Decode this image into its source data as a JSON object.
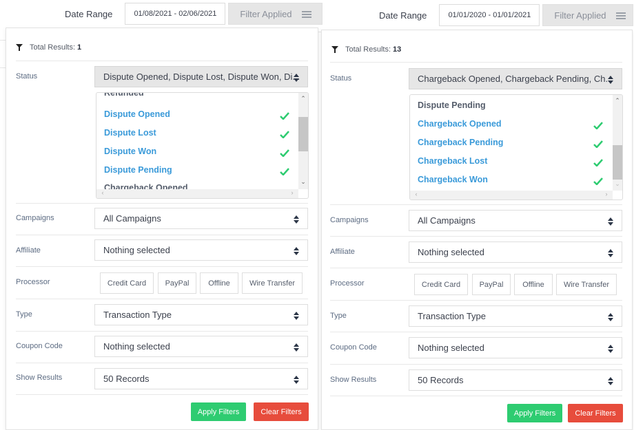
{
  "left": {
    "date_label": "Date Range",
    "date_value": "01/08/2021 - 02/06/2021",
    "filter_button": "Filter Applied",
    "total_label": "Total Results:",
    "total_value": "1",
    "labels": {
      "status": "Status",
      "campaigns": "Campaigns",
      "affiliate": "Affiliate",
      "processor": "Processor",
      "type": "Type",
      "coupon": "Coupon Code",
      "show_results": "Show Results"
    },
    "status_value": "Dispute Opened, Dispute Lost, Dispute Won, Di...",
    "status_options": [
      {
        "label": "Refunded",
        "selected": false
      },
      {
        "label": "Dispute Opened",
        "selected": true
      },
      {
        "label": "Dispute Lost",
        "selected": true
      },
      {
        "label": "Dispute Won",
        "selected": true
      },
      {
        "label": "Dispute Pending",
        "selected": true
      },
      {
        "label": "Chargeback Opened",
        "selected": false
      }
    ],
    "campaigns_value": "All Campaigns",
    "affiliate_value": "Nothing selected",
    "processors": [
      "Credit Card",
      "PayPal",
      "Offline",
      "Wire Transfer"
    ],
    "type_value": "Transaction Type",
    "coupon_value": "Nothing selected",
    "show_results_value": "50 Records",
    "apply_label": "Apply Filters",
    "clear_label": "Clear Filters"
  },
  "right": {
    "date_label": "Date Range",
    "date_value": "01/01/2020 - 01/01/2021",
    "filter_button": "Filter Applied",
    "total_label": "Total Results:",
    "total_value": "13",
    "labels": {
      "status": "Status",
      "campaigns": "Campaigns",
      "affiliate": "Affiliate",
      "processor": "Processor",
      "type": "Type",
      "coupon": "Coupon Code",
      "show_results": "Show Results"
    },
    "status_value": "Chargeback Opened, Chargeback Pending, Ch...",
    "status_options": [
      {
        "label": "Dispute Pending",
        "selected": false
      },
      {
        "label": "Chargeback Opened",
        "selected": true
      },
      {
        "label": "Chargeback Pending",
        "selected": true
      },
      {
        "label": "Chargeback Lost",
        "selected": true
      },
      {
        "label": "Chargeback Won",
        "selected": true
      }
    ],
    "campaigns_value": "All Campaigns",
    "affiliate_value": "Nothing selected",
    "processors": [
      "Credit Card",
      "PayPal",
      "Offline",
      "Wire Transfer"
    ],
    "type_value": "Transaction Type",
    "coupon_value": "Nothing selected",
    "show_results_value": "50 Records",
    "apply_label": "Apply Filters",
    "clear_label": "Clear Filters"
  },
  "colors": {
    "selected_option": "#3a9ad9",
    "check": "#2ecc71",
    "apply": "#2ecc71",
    "clear": "#e74c3c"
  }
}
